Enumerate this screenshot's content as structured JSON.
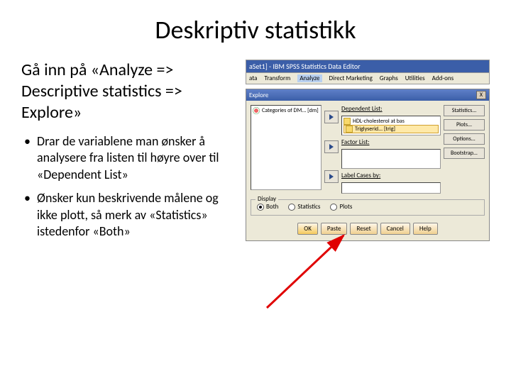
{
  "title": "Deskriptiv statistikk",
  "subtitle": "Gå inn på «Analyze => Descriptive statistics => Explore»",
  "bullets": [
    "Drar de variablene man ønsker å analysere fra listen til høyre over til «Dependent List»",
    "Ønsker kun beskrivende målene og ikke plott, så merk av «Statistics» istedenfor «Both»"
  ],
  "app": {
    "title": "aSet1] - IBM SPSS Statistics Data Editor",
    "menu": [
      "ata",
      "Transform",
      "Analyze",
      "Direct Marketing",
      "Graphs",
      "Utilities",
      "Add-ons"
    ],
    "active_menu": "Analyze"
  },
  "dialog": {
    "title": "Explore",
    "close": "X",
    "source_vars": [
      {
        "icon": "nominal",
        "label": "Categories of DM... [dm]"
      }
    ],
    "dependent": {
      "label": "Dependent List:",
      "items": [
        {
          "icon": "scale",
          "label": "HDL-cholesterol at bas"
        },
        {
          "icon": "scale",
          "label": "Triglyserid... [trig]",
          "selected": true
        }
      ]
    },
    "factor": {
      "label": "Factor List:"
    },
    "labelcases": {
      "label": "Label Cases by:"
    },
    "side_buttons": [
      "Statistics...",
      "Plots...",
      "Options...",
      "Bootstrap..."
    ],
    "display": {
      "legend": "Display",
      "options": [
        {
          "label": "Both",
          "checked": true
        },
        {
          "label": "Statistics",
          "checked": false
        },
        {
          "label": "Plots",
          "checked": false
        }
      ]
    },
    "buttons": {
      "ok": "OK",
      "paste": "Paste",
      "reset": "Reset",
      "cancel": "Cancel",
      "help": "Help"
    }
  }
}
